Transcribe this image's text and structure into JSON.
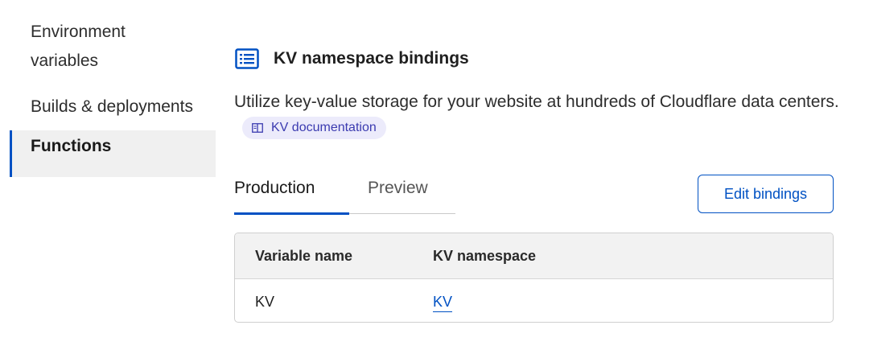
{
  "sidebar": {
    "items": [
      {
        "label_line1": "Environment",
        "label_line2": "variables"
      },
      {
        "label": "Builds & deployments"
      },
      {
        "label": "Functions"
      }
    ]
  },
  "section": {
    "icon": "list-icon",
    "title": "KV namespace bindings",
    "description": "Utilize key-value storage for your website at hundreds of Cloudflare data centers.",
    "doc_link": {
      "icon": "book-icon",
      "label": "KV documentation"
    }
  },
  "tabs": [
    {
      "label": "Production",
      "active": true
    },
    {
      "label": "Preview",
      "active": false
    }
  ],
  "edit_button": {
    "label": "Edit bindings"
  },
  "table": {
    "headers": [
      "Variable name",
      "KV namespace"
    ],
    "rows": [
      {
        "variable_name": "KV",
        "kv_namespace": "KV"
      }
    ]
  },
  "colors": {
    "accent": "#0051c3",
    "doc_link_bg": "#ecebfb",
    "doc_link_text": "#3b3bb0",
    "active_bg": "#f0f0f0"
  }
}
